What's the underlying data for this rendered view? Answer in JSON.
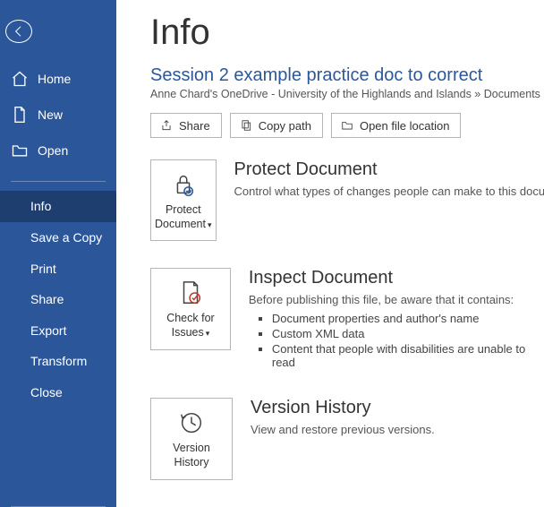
{
  "topHint": "",
  "sidebar": {
    "nav": [
      {
        "label": "Home",
        "icon": "home"
      },
      {
        "label": "New",
        "icon": "new"
      },
      {
        "label": "Open",
        "icon": "open"
      }
    ],
    "sub": [
      {
        "label": "Info",
        "active": true
      },
      {
        "label": "Save a Copy",
        "active": false
      },
      {
        "label": "Print",
        "active": false
      },
      {
        "label": "Share",
        "active": false
      },
      {
        "label": "Export",
        "active": false
      },
      {
        "label": "Transform",
        "active": false
      },
      {
        "label": "Close",
        "active": false
      }
    ]
  },
  "page": {
    "title": "Info",
    "docTitle": "Session 2 example practice doc to correct",
    "breadcrumb": "Anne Chard's OneDrive - University of the Highlands and Islands » Documents » An"
  },
  "toolbar": {
    "share": "Share",
    "copyPath": "Copy path",
    "openLocation": "Open file location"
  },
  "protect": {
    "btnLine1": "Protect",
    "btnLine2": "Document",
    "title": "Protect Document",
    "desc": "Control what types of changes people can make to this docu"
  },
  "inspect": {
    "btnLine1": "Check for",
    "btnLine2": "Issues",
    "title": "Inspect Document",
    "lead": "Before publishing this file, be aware that it contains:",
    "items": [
      "Document properties and author's name",
      "Custom XML data",
      "Content that people with disabilities are unable to read"
    ]
  },
  "version": {
    "btnLine1": "Version",
    "btnLine2": "History",
    "title": "Version History",
    "desc": "View and restore previous versions."
  }
}
